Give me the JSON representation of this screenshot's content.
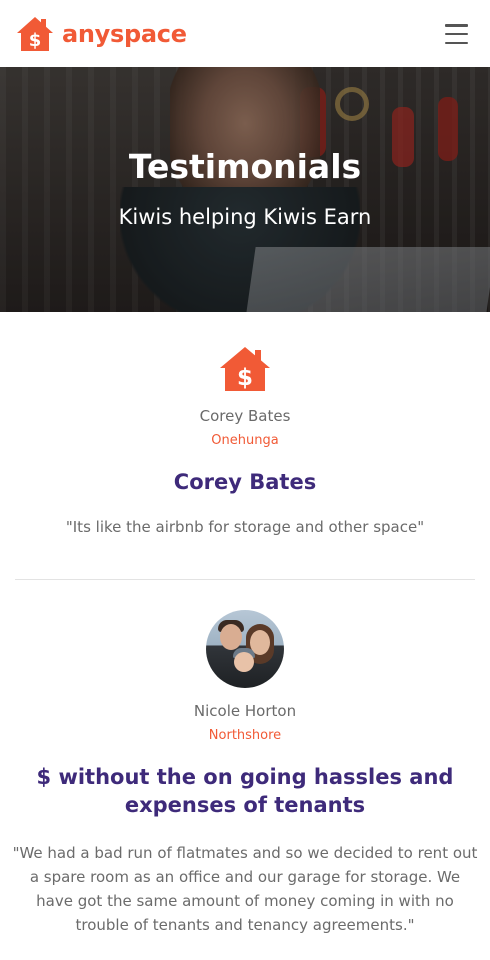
{
  "brand": {
    "name": "anyspace",
    "accent": "#f15a36",
    "headline_color": "#3e2a7a"
  },
  "header": {
    "menu_icon": "hamburger-menu-icon"
  },
  "hero": {
    "title": "Testimonials",
    "subtitle": "Kiwis helping Kiwis Earn"
  },
  "testimonials": [
    {
      "icon": "house-dollar-icon",
      "name": "Corey Bates",
      "location": "Onehunga",
      "headline": "Corey Bates",
      "quote": "\"Its like the airbnb for storage and other space\""
    },
    {
      "icon": "avatar-photo",
      "name": "Nicole Horton",
      "location": "Northshore",
      "headline": "$ without the on going hassles and expenses of tenants",
      "quote": "\"We had a bad run of flatmates and so we decided to rent out a spare room as an office and our garage for storage. We have got the same amount of money coming in with no trouble of tenants and tenancy agreements.\""
    }
  ]
}
